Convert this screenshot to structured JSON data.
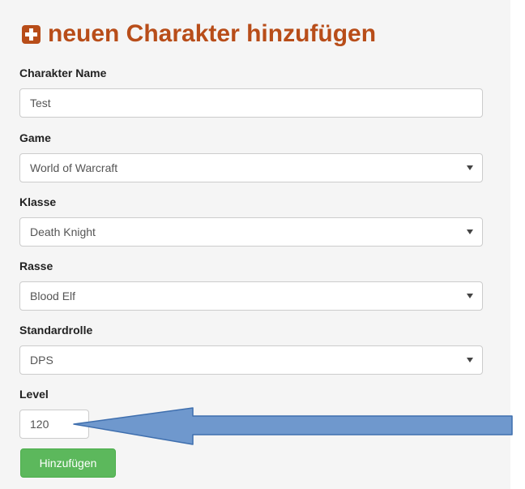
{
  "header": {
    "icon": "plus-square-icon",
    "title": "neuen Charakter hinzufügen",
    "accent_color": "#b84d19"
  },
  "form": {
    "name": {
      "label": "Charakter Name",
      "value": "Test"
    },
    "game": {
      "label": "Game",
      "value": "World of Warcraft"
    },
    "klasse": {
      "label": "Klasse",
      "value": "Death Knight"
    },
    "rasse": {
      "label": "Rasse",
      "value": "Blood Elf"
    },
    "rolle": {
      "label": "Standardrolle",
      "value": "DPS"
    },
    "level": {
      "label": "Level",
      "value": "120"
    },
    "submit_label": "Hinzufügen",
    "submit_color": "#5cb85c"
  },
  "annotation": {
    "icon": "arrow-left-icon",
    "color": "#6f98cd"
  }
}
